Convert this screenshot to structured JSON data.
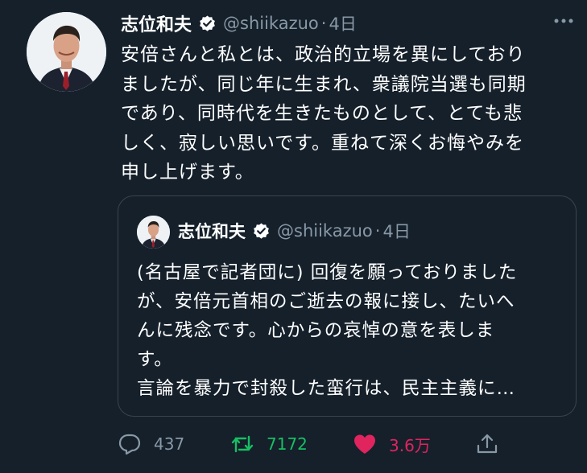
{
  "tweet": {
    "author_name": "志位和夫",
    "handle": "@shiikazuo",
    "separator": "·",
    "time": "4日",
    "text_lines": [
      "安倍さんと私とは、政治的立場を異にしており",
      "ましたが、同じ年に生まれ、衆議院当選も同期",
      "であり、同時代を生きたものとして、とても悲",
      "しく、寂しい思いです。重ねて深くお悔やみを",
      "申し上げます。"
    ]
  },
  "quoted_tweet": {
    "author_name": "志位和夫",
    "handle": "@shiikazuo",
    "separator": "·",
    "time": "4日",
    "text_lines": [
      "(名古屋で記者団に) 回復を願っておりました",
      "が、安倍元首相のご逝去の報に接し、たいへ",
      "んに残念です。心からの哀悼の意を表しま",
      "す。",
      "言論を暴力で封殺した蛮行は、民主主義に…"
    ]
  },
  "actions": {
    "reply_count": "437",
    "retweet_count": "7172",
    "like_count": "3.6万",
    "share_icon": "share-icon"
  },
  "colors": {
    "background": "#15202b",
    "secondary_text": "#8899a6",
    "retweet": "#17bf63",
    "like": "#e0245e"
  }
}
